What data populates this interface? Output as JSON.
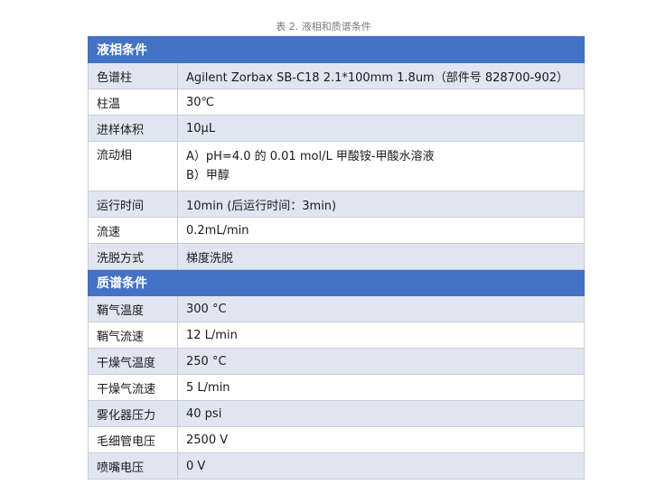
{
  "caption": "表 2. 液相和质谱条件",
  "lc_section": {
    "label": "液相条件",
    "value": ""
  },
  "lc_rows": [
    {
      "param": "色谱柱",
      "value": "Agilent Zorbax SB-C18 2.1*100mm 1.8um（部件号 828700-902）"
    },
    {
      "param": "柱温",
      "value": "30℃"
    },
    {
      "param": "进样体积",
      "value": "10μL"
    },
    {
      "param": "流动相",
      "value_a": "A）pH=4.0 的 0.01 mol/L 甲酸铵-甲酸水溶液",
      "value_b": "B）甲醇"
    },
    {
      "param": "运行时间",
      "value": "10min (后运行时间：3min)"
    },
    {
      "param": "流速",
      "value": "0.2mL/min"
    },
    {
      "param": "洗脱方式",
      "value": "梯度洗脱"
    }
  ],
  "ms_section": {
    "label": "质谱条件",
    "value": ""
  },
  "ms_rows": [
    {
      "param": "鞘气温度",
      "value": "300 °C"
    },
    {
      "param": "鞘气流速",
      "value": "12 L/min"
    },
    {
      "param": "干燥气温度",
      "value": "250 °C"
    },
    {
      "param": "干燥气流速",
      "value": "5 L/min"
    },
    {
      "param": "雾化器压力",
      "value": "40 psi"
    },
    {
      "param": "毛细管电压",
      "value": "2500 V"
    },
    {
      "param": "喷嘴电压",
      "value": "0 V"
    }
  ],
  "colors": {
    "header": "#4472c4",
    "row_alt": "#dfe6f2",
    "row_plain": "#ffffff",
    "border": "#c8ccd6"
  }
}
